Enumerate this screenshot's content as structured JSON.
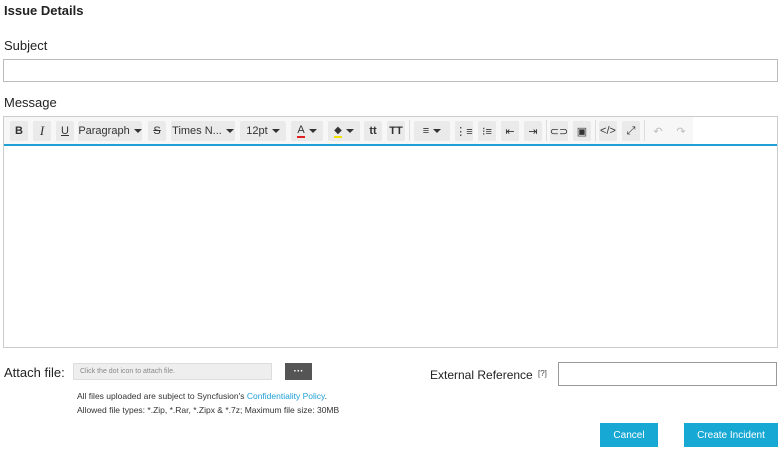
{
  "title": "Issue Details",
  "subject": {
    "label": "Subject",
    "value": ""
  },
  "message": {
    "label": "Message",
    "toolbar": {
      "paragraph": "Paragraph",
      "font": "Times N...",
      "size": "12pt",
      "font_color": "#e02020",
      "bg_color": "#f0e000"
    }
  },
  "attach": {
    "label": "Attach file:",
    "placeholder": "Click the dot icon to attach file.",
    "browse": "···",
    "note_prefix": "All files uploaded are subject to Syncfusion's ",
    "note_link": "Confidentiality Policy",
    "note_suffix": ".",
    "types": "Allowed file types: *.Zip, *.Rar, *.Zipx & *.7z; Maximum file size: 30MB"
  },
  "external": {
    "label": "External Reference",
    "help": "[?]",
    "value": ""
  },
  "buttons": {
    "cancel": "Cancel",
    "create": "Create Incident"
  },
  "colors": {
    "accent": "#17a8d4"
  }
}
